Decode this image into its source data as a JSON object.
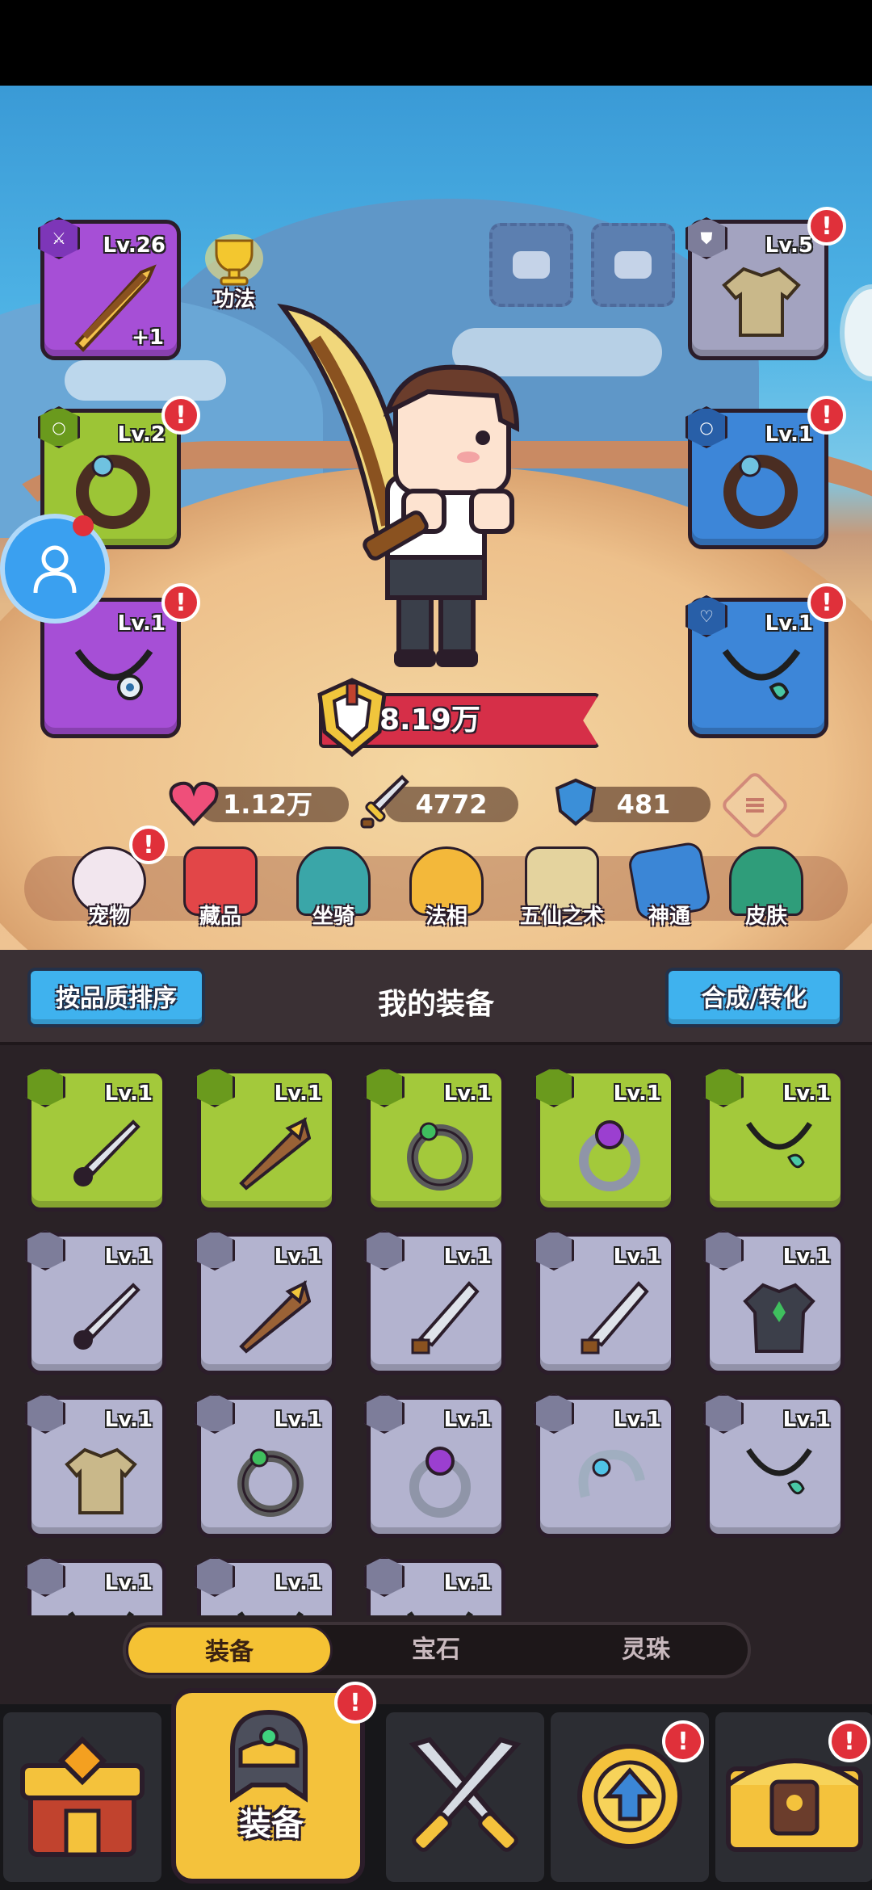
{
  "hero": {
    "skill_label": "功法",
    "power": "8.19万",
    "stats": {
      "hp": "1.12万",
      "attack": "4772",
      "defense": "481"
    }
  },
  "equipped": {
    "weapon": {
      "level": "Lv.26",
      "bonus": "+1"
    },
    "ring_left": {
      "level": "Lv.2"
    },
    "necklace_left": {
      "level": "Lv.1"
    },
    "armor": {
      "level": "Lv.5"
    },
    "ring_right": {
      "level": "Lv.1"
    },
    "necklace_right": {
      "level": "Lv.1"
    }
  },
  "functions": [
    {
      "label": "宠物",
      "color": "#f2e6ee"
    },
    {
      "label": "藏品",
      "color": "#e24648"
    },
    {
      "label": "坐骑",
      "color": "#3aa6a8"
    },
    {
      "label": "法相",
      "color": "#f3b83a"
    },
    {
      "label": "五仙之术",
      "color": "#e4d39e"
    },
    {
      "label": "神通",
      "color": "#3b86d6"
    },
    {
      "label": "皮肤",
      "color": "#2f9d7a"
    }
  ],
  "panel": {
    "sort_button": "按品质排序",
    "title": "我的装备",
    "merge_button": "合成/转化"
  },
  "inventory": [
    {
      "level": "Lv.1",
      "quality": "green",
      "icon": "sword"
    },
    {
      "level": "Lv.1",
      "quality": "green",
      "icon": "spear"
    },
    {
      "level": "Lv.1",
      "quality": "green",
      "icon": "ring"
    },
    {
      "level": "Lv.1",
      "quality": "green",
      "icon": "ring-gem"
    },
    {
      "level": "Lv.1",
      "quality": "green",
      "icon": "necklace"
    },
    {
      "level": "Lv.1",
      "quality": "gray",
      "icon": "sword"
    },
    {
      "level": "Lv.1",
      "quality": "gray",
      "icon": "spear"
    },
    {
      "level": "Lv.1",
      "quality": "gray",
      "icon": "blade"
    },
    {
      "level": "Lv.1",
      "quality": "gray",
      "icon": "blade"
    },
    {
      "level": "Lv.1",
      "quality": "gray",
      "icon": "robe"
    },
    {
      "level": "Lv.1",
      "quality": "gray",
      "icon": "shirt"
    },
    {
      "level": "Lv.1",
      "quality": "gray",
      "icon": "ring"
    },
    {
      "level": "Lv.1",
      "quality": "gray",
      "icon": "ring-gem"
    },
    {
      "level": "Lv.1",
      "quality": "gray",
      "icon": "bracelet"
    },
    {
      "level": "Lv.1",
      "quality": "gray",
      "icon": "necklace"
    },
    {
      "level": "Lv.1",
      "quality": "gray",
      "icon": "necklace"
    },
    {
      "level": "Lv.1",
      "quality": "gray",
      "icon": "necklace"
    },
    {
      "level": "Lv.1",
      "quality": "gray",
      "icon": "necklace"
    }
  ],
  "tabs": [
    {
      "label": "装备",
      "active": true
    },
    {
      "label": "宝石",
      "active": false
    },
    {
      "label": "灵珠",
      "active": false
    }
  ],
  "nav": {
    "active_label": "装备"
  }
}
